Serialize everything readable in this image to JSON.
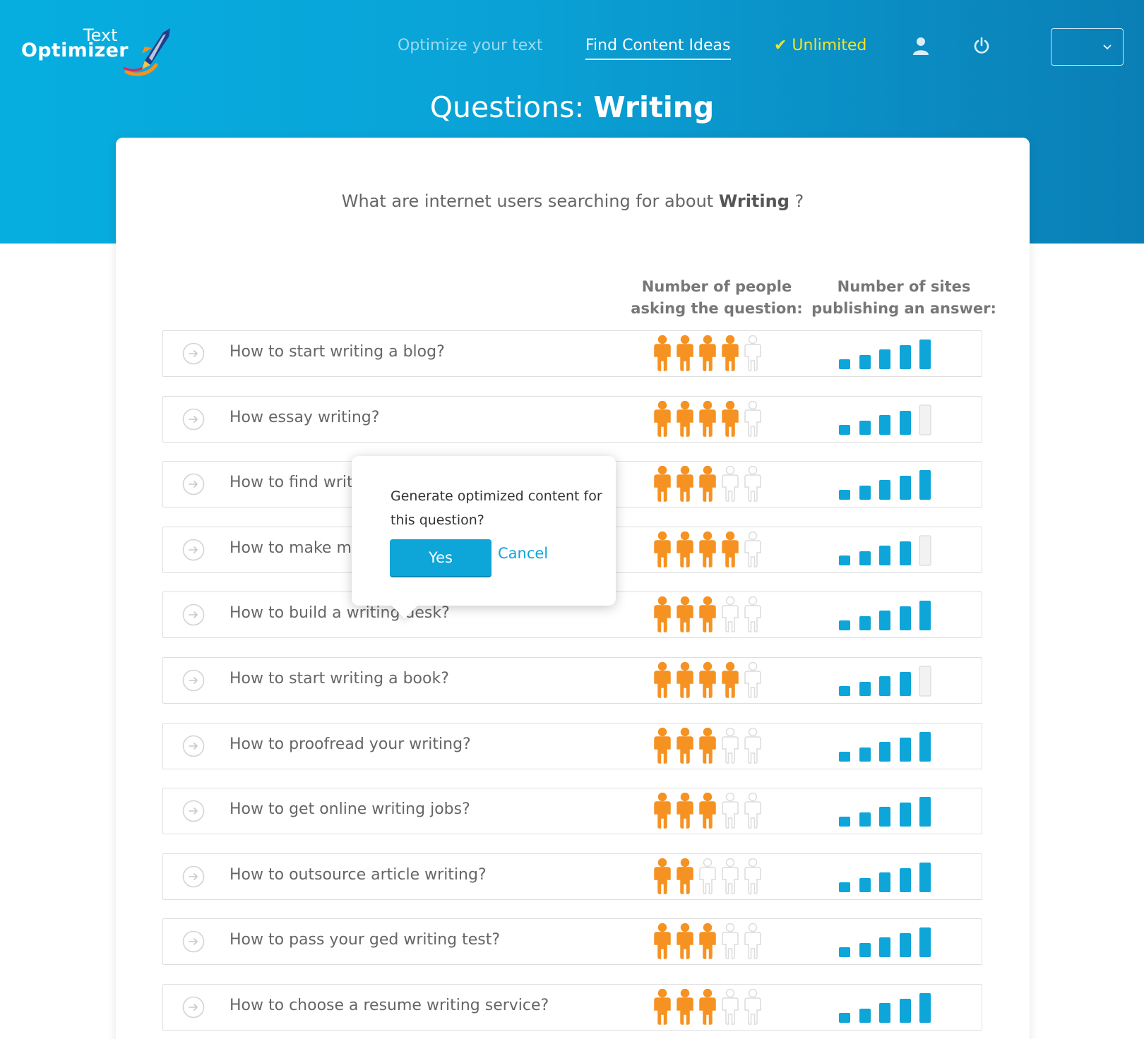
{
  "app": {
    "logo_top": "Text",
    "logo_bottom": "Optimizer"
  },
  "nav": {
    "optimize": "Optimize your text",
    "ideas": "Find Content Ideas",
    "unlimited": "✔ Unlimited",
    "user_icon": "user-icon",
    "power_icon": "power-icon",
    "language_value": ""
  },
  "page": {
    "title_prefix": "Questions: ",
    "title_topic": "Writing",
    "subtitle_prefix": "What are internet users searching for about ",
    "subtitle_topic": "Writing",
    "subtitle_suffix": " ?"
  },
  "columns": {
    "people_line1": "Number of people",
    "people_line2": "asking the question:",
    "sites_line1": "Number of sites",
    "sites_line2": "publishing an answer:"
  },
  "colors": {
    "accent": "#0ea5d8",
    "people_active": "#f59222",
    "people_inactive": "#dcdcdc",
    "bar_active": "#0ea5d8",
    "bar_inactive": "#ebebeb",
    "unlimited": "#f6e324"
  },
  "rows": [
    {
      "question": "How to start writing a blog?",
      "people": 4,
      "sites": 5
    },
    {
      "question": "How essay writing?",
      "people": 4,
      "sites": 4
    },
    {
      "question": "How to find writ",
      "people": 3,
      "sites": 5
    },
    {
      "question": "How to make m",
      "people": 4,
      "sites": 4
    },
    {
      "question": "How to build a writing desk?",
      "people": 3,
      "sites": 5
    },
    {
      "question": "How to start writing a book?",
      "people": 4,
      "sites": 4
    },
    {
      "question": "How to proofread your writing?",
      "people": 3,
      "sites": 5
    },
    {
      "question": "How to get online writing jobs?",
      "people": 3,
      "sites": 5
    },
    {
      "question": "How to outsource article writing?",
      "people": 2,
      "sites": 5
    },
    {
      "question": "How to pass your ged writing test?",
      "people": 3,
      "sites": 5
    },
    {
      "question": "How to choose a resume writing service?",
      "people": 3,
      "sites": 5
    }
  ],
  "popover": {
    "message": "Generate optimized content for this question?",
    "yes": "Yes",
    "cancel": "Cancel"
  }
}
